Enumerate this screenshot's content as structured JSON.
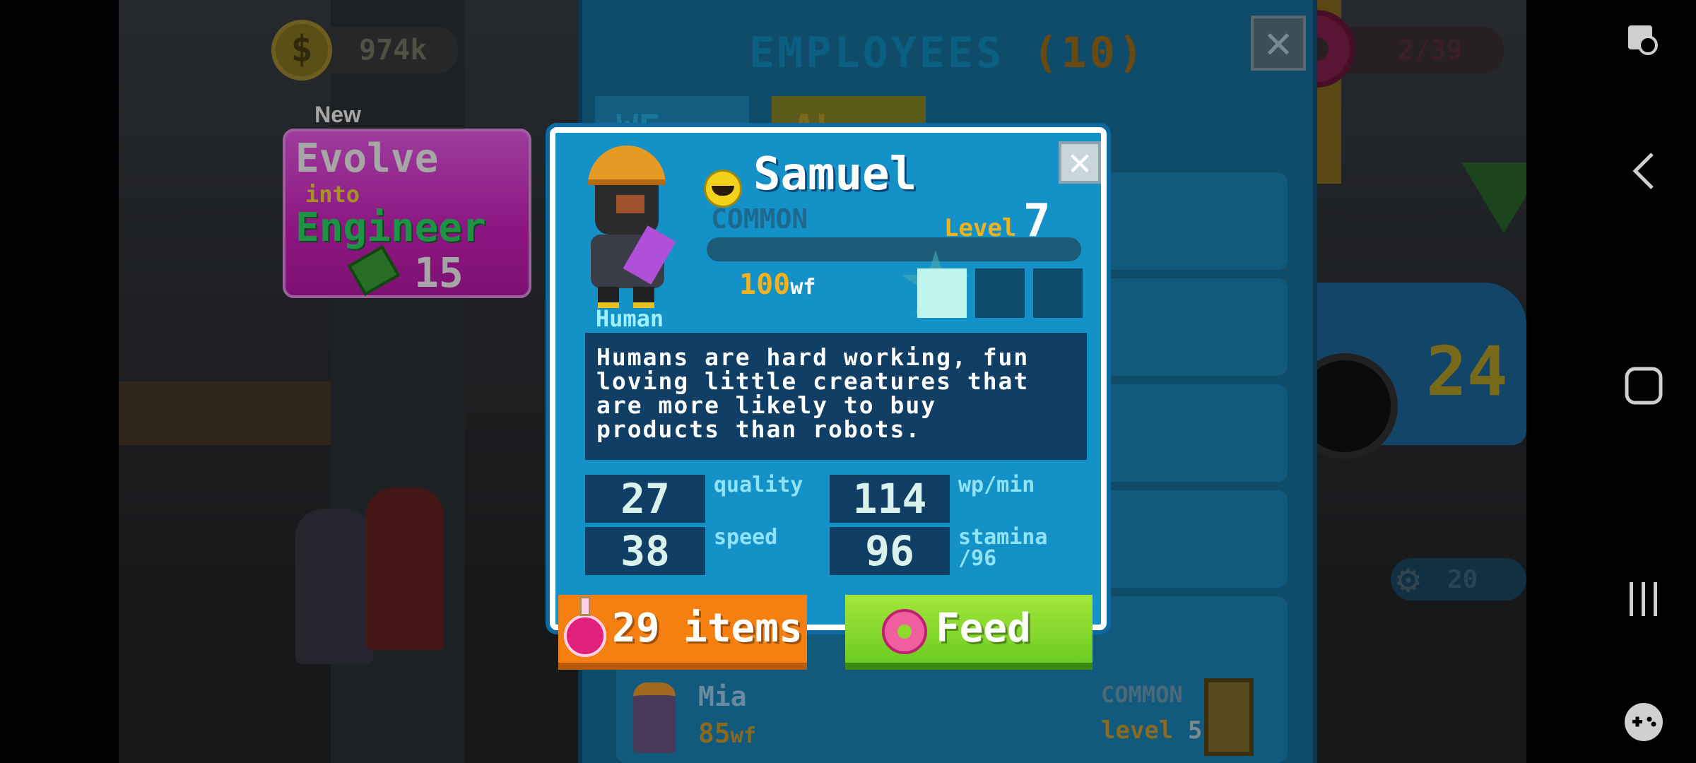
{
  "hud": {
    "coins": "974k",
    "donuts": "2/39"
  },
  "panel": {
    "title": "EMPLOYEES",
    "count": "(10)",
    "tab_1": "WE",
    "tab_2": "AL"
  },
  "evolve_card": {
    "badge": "New",
    "line1": "Evolve",
    "line2": "into",
    "line3": "Engineer",
    "cost": "15"
  },
  "employee": {
    "name": "Samuel",
    "rarity": "COMMON",
    "level_label": "Level",
    "level": "7",
    "race": "Human",
    "wf_value": "100",
    "wf_unit": "wf",
    "description": "Humans are hard working, fun\nloving little creatures that\nare more likely to buy\nproducts than robots.",
    "stats": {
      "quality_value": "27",
      "quality_label": "quality",
      "wpmin_value": "114",
      "wpmin_label": "wp/min",
      "speed_value": "38",
      "speed_label": "speed",
      "stamina_value": "96",
      "stamina_label": "stamina\n/96"
    },
    "xp_progress": 0,
    "star_slots_filled": 1,
    "star_slots_total": 3
  },
  "buttons": {
    "items_label": "29 items",
    "feed_label": "Feed"
  },
  "list_row": {
    "name": "Mia",
    "wf_value": "85",
    "wf_unit": "wf",
    "rarity": "COMMON",
    "level_label": "level",
    "level": "5"
  },
  "background": {
    "car_number": "24",
    "meter_value": "20"
  },
  "colors": {
    "dialog_bg": "#1492c8",
    "items_button": "#f57f10",
    "feed_button": "#7ed321",
    "evolve_card": "#d722c6",
    "engineer_text": "#2ee06b"
  }
}
